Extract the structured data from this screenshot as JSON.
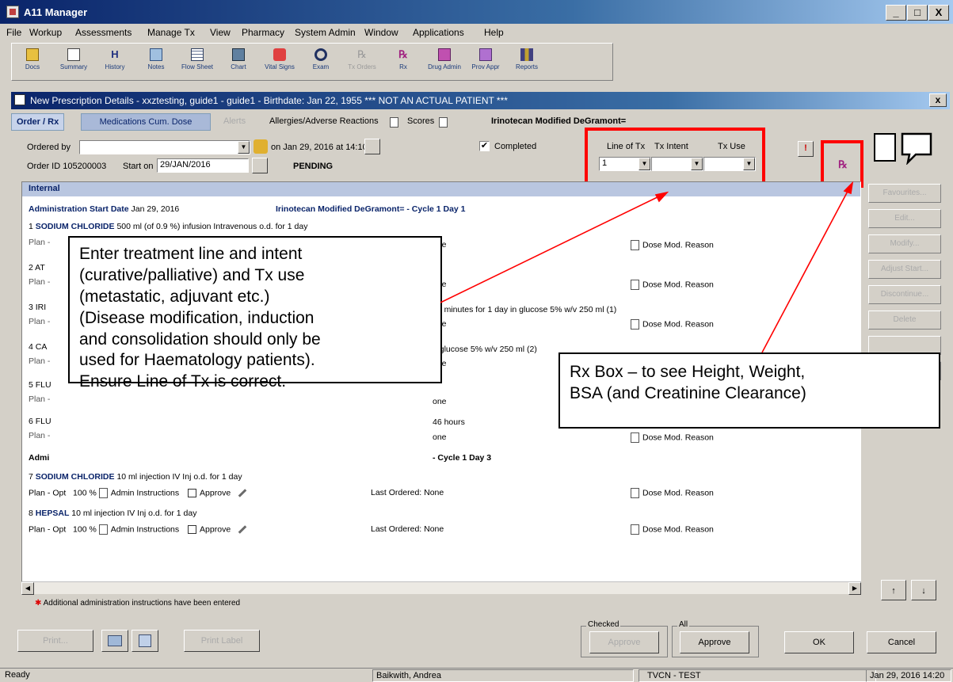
{
  "window": {
    "title": "A11 Manager",
    "minimize": "_",
    "maximize": "□",
    "close": "X"
  },
  "menu": [
    "File",
    "Workup",
    "Assessments",
    "Manage Tx",
    "View",
    "Pharmacy",
    "System Admin",
    "Window",
    "Applications",
    "Help"
  ],
  "toolbar": [
    "Docs",
    "Summary",
    "History",
    "Notes",
    "Flow Sheet",
    "Chart",
    "Vital Signs",
    "Exam",
    "Tx Orders",
    "Rx",
    "Drug Admin",
    "Prov Appr",
    "Reports"
  ],
  "child_window": {
    "title": "New Prescription Details - xxztesting, guide1  - guide1 - Birthdate: Jan 22, 1955 *** NOT AN ACTUAL PATIENT ***",
    "close": "x"
  },
  "tabs": {
    "order": "Order / Rx",
    "medications": "Medications Cum. Dose",
    "alerts": "Alerts",
    "allergies": "Allergies/Adverse Reactions",
    "scores": "Scores",
    "regimen": "Irinotecan Modified DeGramont="
  },
  "order": {
    "ordered_by_label": "Ordered by",
    "ordered_on": "on Jan 29, 2016  at 14:10",
    "completed_label": "Completed",
    "completed_mark": "✔",
    "order_id": "Order ID 105200003",
    "start_on_label": "Start on",
    "start_on_value": "29/JAN/2016",
    "status": "PENDING",
    "line_of_tx_label": "Line of Tx",
    "tx_intent_label": "Tx Intent",
    "tx_use_label": "Tx Use",
    "line_of_tx_value": "1",
    "warning": "!"
  },
  "list": {
    "header": "Internal",
    "admin_start_1": {
      "label": "Administration Start Date",
      "date": "Jan 29, 2016",
      "cycle": "Irinotecan Modified DeGramont= - Cycle 1 Day 1"
    },
    "item1": {
      "num": "1",
      "drug": "SODIUM CHLORIDE",
      "desc": "500 ml (of 0.9 %) infusion Intravenous o.d. for 1 day"
    },
    "plan_short": "Plan -",
    "frag_none": "one",
    "frag_atr": "2  AT",
    "frag_iri": "3  IRI",
    "frag_iri_desc": "30 minutes for 1 day in glucose 5% w/v 250 ml (1)",
    "frag_ca": "4  CA",
    "frag_ca_desc": "n glucose 5% w/v 250 ml (2)",
    "frag_flu5": "5  FLU",
    "frag_flu6": "6  FLU",
    "frag_flu6_desc": "46 hours",
    "frag_admin": "Admi",
    "frag_cycle3": "- Cycle 1 Day 3",
    "dose_mod": "Dose Mod. Reason",
    "item7": {
      "num": "7",
      "drug": "SODIUM CHLORIDE",
      "desc": "10 ml injection IV Inj o.d. for 1 day"
    },
    "item8": {
      "num": "8",
      "drug": "HEPSAL",
      "desc": "10 ml injection IV Inj o.d. for 1 day"
    },
    "plan_opt": "Plan - Opt",
    "percent": "100 %",
    "admin_instructions": "Admin Instructions",
    "approve": "Approve",
    "last_ordered": "Last Ordered: None",
    "footer_note": "Additional administration instructions have been entered"
  },
  "side_buttons": [
    "Favourites...",
    "Edit...",
    "Modify...",
    "Adjust Start...",
    "Discontinue...",
    "Delete"
  ],
  "bottom": {
    "print": "Print...",
    "print_label": "Print Label",
    "checked_caption": "Checked",
    "all_caption": "All",
    "approve_checked": "Approve",
    "approve_all": "Approve",
    "ok": "OK",
    "cancel": "Cancel"
  },
  "status": {
    "ready": "Ready",
    "user": "Baikwith, Andrea",
    "env": "TVCN - TEST",
    "datetime": "Jan 29, 2016 14:20"
  },
  "callout_left": [
    "Enter treatment line and intent",
    "(curative/palliative) and Tx use",
    "(metastatic, adjuvant etc.)",
    "(Disease modification, induction",
    "and consolidation should only be",
    "used for Haematology patients).",
    "Ensure Line of Tx is correct."
  ],
  "callout_right": [
    "Rx Box – to see Height, Weight,",
    "BSA (and Creatinine Clearance)"
  ],
  "colors": {
    "annotation_red": "#ff0000",
    "title_blue": "#0a246a"
  }
}
